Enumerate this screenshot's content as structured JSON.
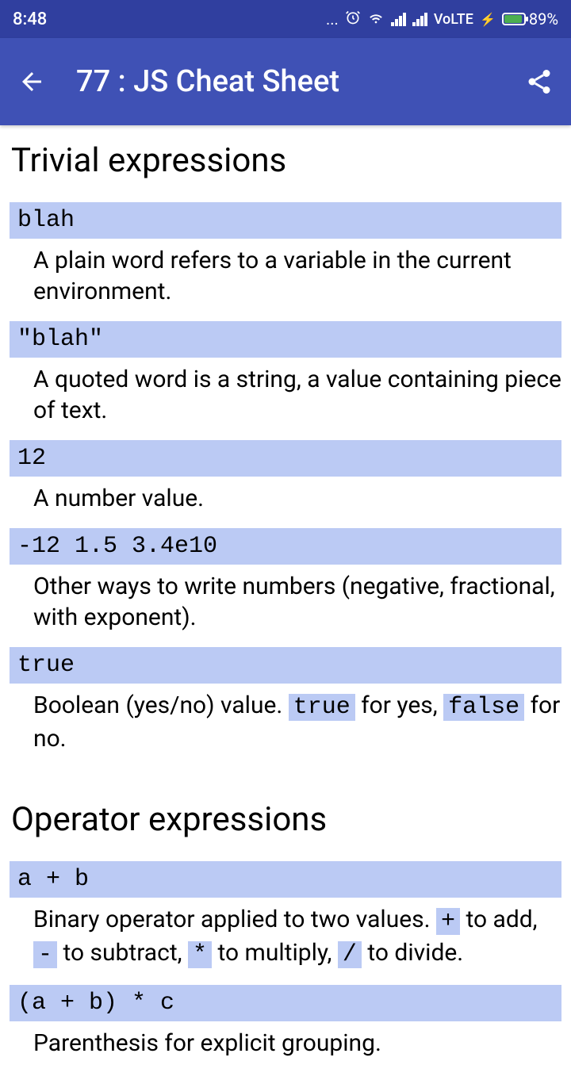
{
  "status_bar": {
    "time": "8:48",
    "volte": "VoLTE",
    "battery_percent": "89%"
  },
  "app_bar": {
    "title": "77 : JS Cheat Sheet"
  },
  "sections": [
    {
      "title": "Trivial expressions",
      "items": [
        {
          "code": "blah",
          "desc_parts": [
            "A plain word refers to a variable in the current environment."
          ]
        },
        {
          "code": "\"blah\"",
          "desc_parts": [
            "A quoted word is a string, a value containing piece of text."
          ]
        },
        {
          "code": "12",
          "desc_parts": [
            "A number value."
          ]
        },
        {
          "code": "-12 1.5 3.4e10",
          "desc_parts": [
            "Other ways to write numbers (negative, fractional, with exponent)."
          ]
        },
        {
          "code": "true",
          "desc_parts": [
            "Boolean (yes/no) value. ",
            {
              "code": "true"
            },
            " for yes, ",
            {
              "code": "false"
            },
            " for no."
          ]
        }
      ]
    },
    {
      "title": "Operator expressions",
      "items": [
        {
          "code": "a + b",
          "desc_parts": [
            "Binary operator applied to two values. ",
            {
              "code": "+"
            },
            " to add, ",
            {
              "code": "-"
            },
            " to subtract, ",
            {
              "code": "*"
            },
            " to multiply, ",
            {
              "code": "/"
            },
            " to divide."
          ]
        },
        {
          "code": "(a + b) * c",
          "desc_parts": [
            "Parenthesis for explicit grouping."
          ]
        }
      ]
    }
  ]
}
